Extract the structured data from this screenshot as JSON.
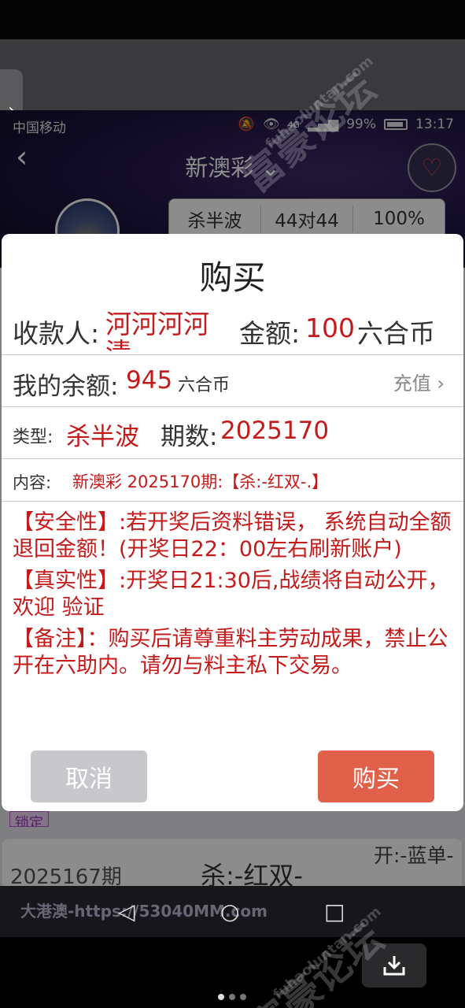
{
  "status_bar": {
    "carrier": "中国移动",
    "battery": "99%",
    "time": "13:17",
    "network": "4G"
  },
  "nav": {
    "title": "新澳彩 ⌄"
  },
  "stats": {
    "kill": "杀半波",
    "record": "44对44",
    "rate": "100%"
  },
  "dialog": {
    "title": "购买",
    "payee_label": "收款人:",
    "payee_value": "河河河河清",
    "amount_label": "金额:",
    "amount_value": "100",
    "amount_unit": "六合币",
    "balance_label": "我的余额:",
    "balance_value": "945",
    "balance_unit": "六合币",
    "recharge_label": "充值",
    "type_label": "类型:",
    "type_value": "杀半波",
    "period_label": "期数:",
    "period_value": "2025170",
    "content_label": "内容:",
    "content_value": "新澳彩 2025170期:【杀:-红双-.】",
    "note_safety": "【安全性】:若开奖后资料错误， 系统自动全额退回金额！(开奖日22：00左右刷新账户)",
    "note_truth": "【真实性】:开奖日21:30后,战绩将自动公开，欢迎 验证",
    "note_remark": "【备注】：购买后请尊重料主劳动成果，禁止公开在六助内。请勿与料主私下交易。",
    "cancel_label": "取消",
    "buy_label": "购买"
  },
  "record": {
    "locked_tag": "锁定",
    "period": "2025167期",
    "kill": "杀:-红双-",
    "open": "开:-蓝单-"
  },
  "navbar": {
    "url_text": "大港澳-https://53040MM.com"
  },
  "watermarks": {
    "text_cn": "富豪论坛",
    "text_en": "fuhaoluntan.com"
  },
  "colors": {
    "accent_red": "#c41a1a",
    "buy_button": "#e0604a",
    "cancel_button": "#c8c8cc"
  }
}
